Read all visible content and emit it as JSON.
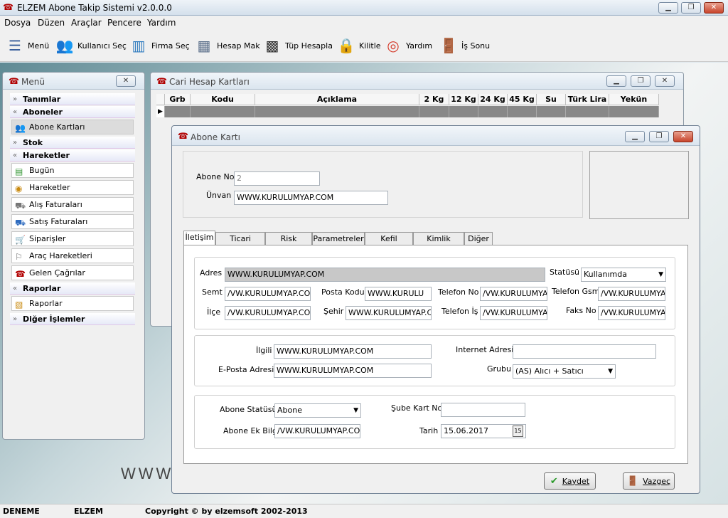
{
  "app": {
    "title": "ELZEM Abone Takip Sistemi v2.0.0.0",
    "accent_color": "#b10000"
  },
  "menubar": [
    "Dosya",
    "Düzen",
    "Araçlar",
    "Pencere",
    "Yardım"
  ],
  "toolbar": [
    {
      "label": "Menü",
      "icon": "menu-icon"
    },
    {
      "label": "Kullanıcı Seç",
      "icon": "users-icon"
    },
    {
      "label": "Firma Seç",
      "icon": "buildings-icon"
    },
    {
      "label": "Hesap Mak",
      "icon": "calculator-icon"
    },
    {
      "label": "Tüp Hesapla",
      "icon": "calculator2-icon"
    },
    {
      "label": "Kilitle",
      "icon": "lock-user-icon"
    },
    {
      "label": "Yardım",
      "icon": "lifebuoy-icon"
    },
    {
      "label": "İş Sonu",
      "icon": "exit-door-icon"
    }
  ],
  "menu_panel": {
    "title": "Menü",
    "sections": {
      "tanimlar": "Tanımlar",
      "aboneler": "Aboneler",
      "stok": "Stok",
      "hareketler": "Hareketler",
      "raporlar": "Raporlar",
      "diger": "Diğer İşlemler"
    },
    "items": {
      "abone_kartlari": "Abone Kartları",
      "bugun": "Bugün",
      "hareketler": "Hareketler",
      "alis": "Alış Faturaları",
      "satis": "Satış Faturaları",
      "siparisler": "Siparişler",
      "arac": "Araç Hareketleri",
      "gelen": "Gelen Çağrılar",
      "raporlar": "Raporlar"
    }
  },
  "cari": {
    "title": "Cari Hesap Kartları",
    "columns": [
      "Grb",
      "Kodu",
      "Açıklama",
      "2 Kg",
      "12 Kg",
      "24 Kg",
      "45 Kg",
      "Su",
      "Türk Lira",
      "Yekün"
    ]
  },
  "abone": {
    "title": "Abone Kartı",
    "abone_no_label": "Abone No",
    "abone_no": "2",
    "unvan_label": "Ünvan",
    "unvan": "WWW.KURULUMYAP.COM",
    "tabs": [
      "İletişim",
      "Ticari Bilgiler",
      "Risk Bilgileri",
      "Parametreler",
      "Kefil Bilgileri",
      "Kimlik Bilgileri",
      "Diğer"
    ],
    "iletisim": {
      "adres_label": "Adres",
      "adres": "WWW.KURULUMYAP.COM",
      "statusu_label": "Statüsü",
      "statusu": "Kullanımda",
      "semt_label": "Semt",
      "semt": "/VW.KURULUMYAP.COM",
      "posta_label": "Posta Kodu",
      "posta": "WWW.KURULU",
      "tel_label": "Telefon No",
      "tel": "/VW.KURULUMYAP.",
      "gsm_label": "Telefon Gsm",
      "gsm": "/VW.KURULUMYAP.",
      "ilce_label": "İlçe",
      "ilce": "/VW.KURULUMYAP.COM",
      "sehir_label": "Şehir",
      "sehir": "WWW.KURULUMYAP.COM",
      "telis_label": "Telefon İş",
      "telis": "/VW.KURULUMYAP.",
      "faks_label": "Faks No",
      "faks": "/VW.KURULUMYAP."
    },
    "ilgili": {
      "ilgili_label": "İlgili",
      "ilgili": "WWW.KURULUMYAP.COM",
      "internet_label": "Internet Adresi",
      "internet": "",
      "eposta_label": "E-Posta Adresi",
      "eposta": "WWW.KURULUMYAP.COM",
      "grubu_label": "Grubu",
      "grubu": "(AS) Alıcı + Satıcı"
    },
    "abone_info": {
      "statu_label": "Abone Statüsü",
      "statu": "Abone",
      "sube_label": "Şube Kart No",
      "sube": "",
      "ekbilgi_label": "Abone Ek Bilgi",
      "ekbilgi": "/VW.KURULUMYAP.COM",
      "tarih_label": "Tarih",
      "tarih": "15.06.2017",
      "cal_icon": "15"
    },
    "buttons": {
      "kaydet": "Kaydet",
      "vazgec": "Vazgeç"
    }
  },
  "statusbar": {
    "c1": "DENEME",
    "c2": "ELZEM",
    "c3": "Copyright © by elzemsoft 2002-2013"
  },
  "watermark": "WWW"
}
